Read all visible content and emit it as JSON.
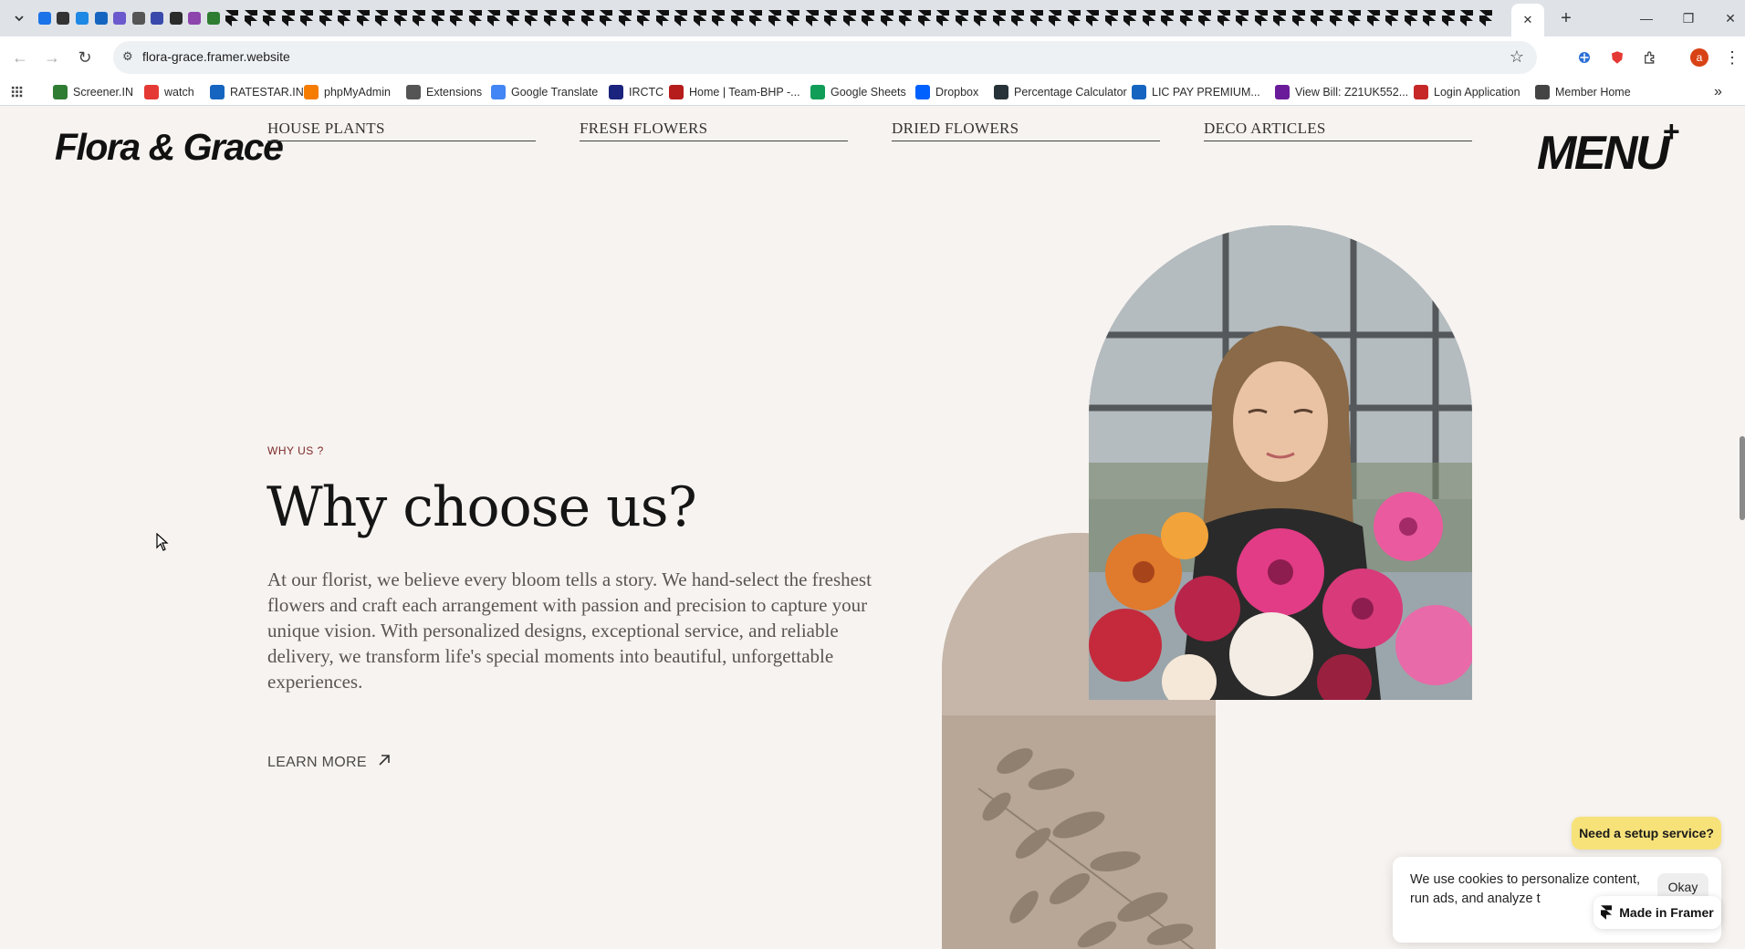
{
  "browser": {
    "url": "flora-grace.framer.website",
    "tab_count_icons": [
      "tab-search-icon",
      "app-a-icon",
      "wix-icon",
      "framer-w-icon",
      "framer-w-icon",
      "hosting-icon",
      "swirl-icon",
      "grid-icon",
      "table-icon",
      "circle-icon",
      "leaf-icon"
    ],
    "window_controls": {
      "minimize": "—",
      "restore": "❐",
      "close": "✕"
    },
    "new_tab": "+",
    "avatar_letter": "a"
  },
  "bookmarks": [
    {
      "label": "Screener.IN",
      "color": "#2e7d32"
    },
    {
      "label": "watch",
      "color": "#e53935"
    },
    {
      "label": "RATESTAR.IN",
      "color": "#1565c0"
    },
    {
      "label": "phpMyAdmin",
      "color": "#f57c00"
    },
    {
      "label": "Extensions",
      "color": "#555555"
    },
    {
      "label": "Google Translate",
      "color": "#4285f4"
    },
    {
      "label": "IRCTC",
      "color": "#1a237e"
    },
    {
      "label": "Home | Team-BHP -...",
      "color": "#b71c1c"
    },
    {
      "label": "Google Sheets",
      "color": "#0f9d58"
    },
    {
      "label": "Dropbox",
      "color": "#0061fe"
    },
    {
      "label": "Percentage Calculator",
      "color": "#263238"
    },
    {
      "label": "LIC PAY PREMIUM...",
      "color": "#1565c0"
    },
    {
      "label": "View Bill: Z21UK552...",
      "color": "#6a1b9a"
    },
    {
      "label": "Login Application",
      "color": "#c62828"
    },
    {
      "label": "Member Home",
      "color": "#444444"
    }
  ],
  "site": {
    "logo": "Flora & Grace",
    "categories": [
      "HOUSE PLANTS",
      "FRESH FLOWERS",
      "DRIED FLOWERS",
      "DECO ARTICLES"
    ],
    "menu_label": "MENU",
    "menu_plus": "+",
    "eyebrow": "WHY US ?",
    "headline": "Why choose us?",
    "body": "At our florist, we believe every bloom tells a story. We hand-select the freshest flowers and craft each arrangement with passion and precision to capture your unique vision. With personalized designs, exceptional service, and reliable delivery, we transform life's special moments into beautiful, unforgettable experiences.",
    "cta": "LEARN MORE",
    "accent_color": "#7b2a2a"
  },
  "overlays": {
    "setup_pill": "Need a setup service?",
    "cookie_text": "We use cookies to personalize content, run ads, and analyze t",
    "cookie_ok": "Okay",
    "framer_badge": "Made in Framer"
  }
}
